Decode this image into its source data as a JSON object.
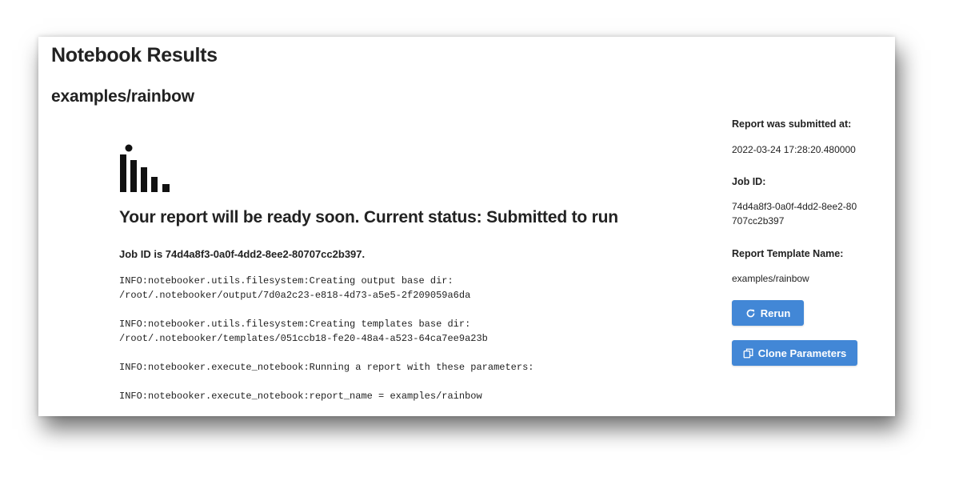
{
  "page": {
    "title": "Notebook Results",
    "report_path": "examples/rainbow"
  },
  "status": {
    "heading": "Your report will be ready soon. Current status: Submitted to run",
    "job_line": "Job ID is 74d4a8f3-0a0f-4dd2-8ee2-80707cc2b397."
  },
  "logs": [
    "INFO:notebooker.utils.filesystem:Creating output base dir:\n/root/.notebooker/output/7d0a2c23-e818-4d73-a5e5-2f209059a6da",
    "INFO:notebooker.utils.filesystem:Creating templates base dir:\n/root/.notebooker/templates/051ccb18-fe20-48a4-a523-64ca7ee9a23b",
    "INFO:notebooker.execute_notebook:Running a report with these parameters:",
    "INFO:notebooker.execute_notebook:report_name = examples/rainbow"
  ],
  "sidebar": {
    "submitted_label": "Report was submitted at:",
    "submitted_value": "2022-03-24 17:28:20.480000",
    "job_id_label": "Job ID:",
    "job_id_value": "74d4a8f3-0a0f-4dd2-8ee2-80707cc2b397",
    "template_label": "Report Template Name:",
    "template_value": "examples/rainbow",
    "rerun_label": "Rerun",
    "clone_label": "Clone Parameters"
  },
  "icons": {
    "logo": "notebooker-bars-logo-icon",
    "rerun": "refresh-icon",
    "clone": "copy-icon"
  },
  "colors": {
    "button": "#4287d6",
    "text": "#222222",
    "logo": "#111111"
  }
}
